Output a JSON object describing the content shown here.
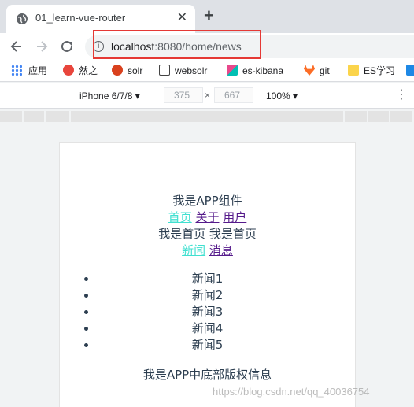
{
  "browser": {
    "tab_title": "01_learn-vue-router",
    "close_glyph": "✕",
    "new_tab_glyph": "+",
    "url_host": "localhost",
    "url_rest": ":8080/home/news",
    "info_glyph": "i"
  },
  "bookmarks": [
    {
      "label": "应用",
      "icon": "apps-grid-icon"
    },
    {
      "label": "然之",
      "icon": "ranzhi-icon",
      "color": "#e8453c"
    },
    {
      "label": "solr",
      "icon": "solr-icon",
      "color": "#d9411e"
    },
    {
      "label": "websolr",
      "icon": "websolr-icon",
      "color": "#444444"
    },
    {
      "label": "es-kibana",
      "icon": "kibana-icon",
      "color": "#e8488b"
    },
    {
      "label": "git",
      "icon": "gitlab-icon",
      "color": "#fc6d26"
    },
    {
      "label": "ES学习",
      "icon": "folder-icon",
      "color": "#fbd44b"
    }
  ],
  "device_toolbar": {
    "device": "iPhone 6/7/8",
    "width": "375",
    "height": "667",
    "times": "×",
    "zoom": "100%"
  },
  "app": {
    "header": "我是APP组件",
    "nav": [
      "首页",
      "关于",
      "用户"
    ],
    "home_text": "我是首页 我是首页",
    "sub_nav": [
      "新闻",
      "消息"
    ],
    "news": [
      "新闻1",
      "新闻2",
      "新闻3",
      "新闻4",
      "新闻5"
    ],
    "footer": "我是APP中底部版权信息"
  },
  "watermark": "https://blog.csdn.net/qq_40036754"
}
